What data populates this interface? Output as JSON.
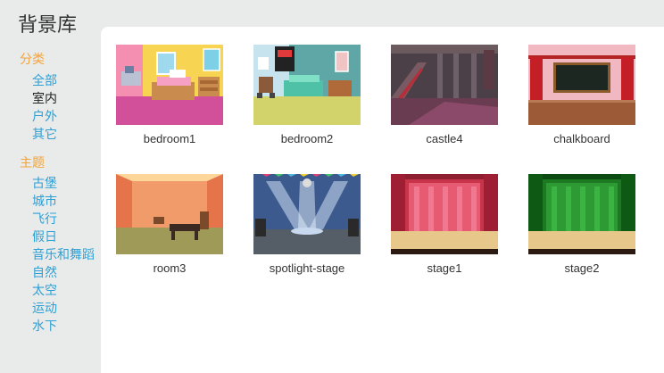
{
  "header": {
    "title": "背景库"
  },
  "sidebar": {
    "category_heading": "分类",
    "categories": [
      {
        "label": "全部",
        "selected": false
      },
      {
        "label": "室内",
        "selected": true
      },
      {
        "label": "户外",
        "selected": false
      },
      {
        "label": "其它",
        "selected": false
      }
    ],
    "theme_heading": "主题",
    "themes": [
      {
        "label": "古堡"
      },
      {
        "label": "城市"
      },
      {
        "label": "飞行"
      },
      {
        "label": "假日"
      },
      {
        "label": "音乐和舞蹈"
      },
      {
        "label": "自然"
      },
      {
        "label": "太空"
      },
      {
        "label": "运动"
      },
      {
        "label": "水下"
      }
    ]
  },
  "library": {
    "items": [
      {
        "name": "bedroom1"
      },
      {
        "name": "bedroom2"
      },
      {
        "name": "castle4"
      },
      {
        "name": "chalkboard"
      },
      {
        "name": "room3"
      },
      {
        "name": "spotlight-stage"
      },
      {
        "name": "stage1"
      },
      {
        "name": "stage2"
      }
    ]
  },
  "colors": {
    "background": "#e9eaea",
    "heading_orange": "#f3a43a",
    "link_blue": "#2fa0d4",
    "selected_text": "#222222"
  }
}
